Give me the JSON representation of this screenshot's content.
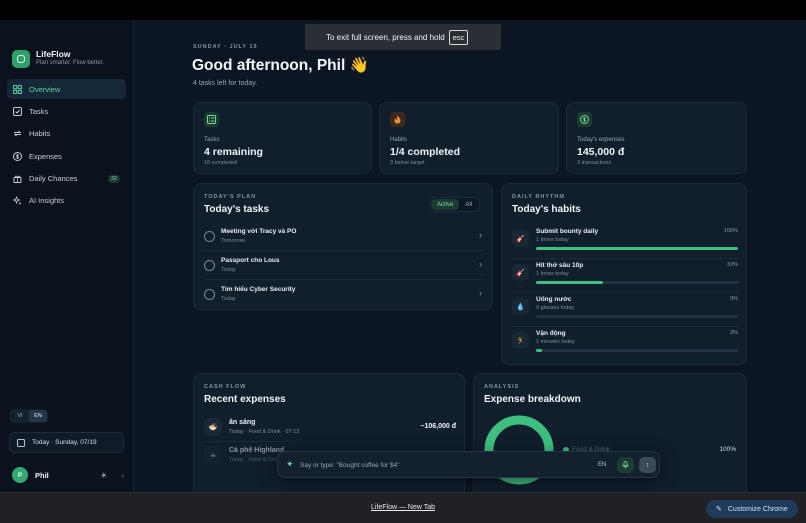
{
  "fullscreen_toast": {
    "text": "To exit full screen, press and hold",
    "key": "esc"
  },
  "brand": {
    "name": "LifeFlow",
    "tagline": "Plan smarter. Flow better."
  },
  "nav": [
    {
      "label": "Overview",
      "icon": "grid-icon",
      "active": true
    },
    {
      "label": "Tasks",
      "icon": "checkbox-icon"
    },
    {
      "label": "Habits",
      "icon": "repeat-icon"
    },
    {
      "label": "Expenses",
      "icon": "dollar-icon"
    },
    {
      "label": "Daily Chances",
      "icon": "gift-icon",
      "badge": "32"
    },
    {
      "label": "AI Insights",
      "icon": "sparkles-icon"
    }
  ],
  "language": {
    "options": [
      "VI",
      "EN"
    ],
    "selected": "EN"
  },
  "date_button": "Today · Sunday, 07/19",
  "user": {
    "initial": "P",
    "name": "Phil"
  },
  "header": {
    "date": "SUNDAY · JULY 19",
    "greeting": "Good afternoon, Phil 👋",
    "subtitle": "4 tasks left for today."
  },
  "stats": [
    {
      "label": "Tasks",
      "value": "4 remaining",
      "sub": "16 completed",
      "icon": "checklist-icon",
      "color": "#3fbf7f"
    },
    {
      "label": "Habits",
      "value": "1/4 completed",
      "sub": "3 below target",
      "icon": "flame-icon",
      "color": "#f08a3c"
    },
    {
      "label": "Today's expenses",
      "value": "145,000 đ",
      "sub": "3 transactions",
      "icon": "coin-icon",
      "color": "#3fbf7f"
    }
  ],
  "plan": {
    "eyebrow": "TODAY'S PLAN",
    "title": "Today's tasks",
    "filters": [
      "Active",
      "All"
    ],
    "active_filter": "Active",
    "tasks": [
      {
        "title": "Meeting với Tracy và PO",
        "due": "Tomorrow"
      },
      {
        "title": "Passport cho Lous",
        "due": "Today"
      },
      {
        "title": "Tìm hiểu Cyber Security",
        "due": "Today"
      }
    ]
  },
  "rhythm": {
    "eyebrow": "DAILY RHYTHM",
    "title": "Today's habits",
    "habits": [
      {
        "title": "Submit bounty daily",
        "sub": "1 times today",
        "pct_label": "100%",
        "progress": 1.0,
        "icon": "guitar-icon"
      },
      {
        "title": "Hít thở sâu 10p",
        "sub": "1 times today",
        "pct_label": "33%",
        "progress": 0.33,
        "icon": "guitar-icon"
      },
      {
        "title": "Uống nước",
        "sub": "0 glasses today",
        "pct_label": "0%",
        "progress": 0.0,
        "icon": "water-drop-icon"
      },
      {
        "title": "Vận động",
        "sub": "1 minutes today",
        "pct_label": "3%",
        "progress": 0.03,
        "icon": "runner-icon"
      }
    ]
  },
  "cashflow": {
    "eyebrow": "CASH FLOW",
    "title": "Recent expenses",
    "items": [
      {
        "title": "ăn sáng",
        "sub": "Today · Food & Drink · 07:13",
        "amount": "−106,000 đ",
        "icon": "food-icon"
      },
      {
        "title": "Cà phê Highland",
        "sub": "Today · Food & Drink",
        "amount": "",
        "icon": "coffee-icon"
      }
    ]
  },
  "analysis": {
    "eyebrow": "ANALYSIS",
    "title": "Expense breakdown",
    "legend": [
      {
        "label": "Food & Drink",
        "pct": "100%",
        "color": "#3fbf7f"
      }
    ]
  },
  "ask": {
    "placeholder": "Say or type: \"Bought coffee for $4\"",
    "lang": "EN"
  },
  "browser": {
    "tab_title": "LifeFlow — New Tab",
    "customize_label": "Customize Chrome"
  }
}
